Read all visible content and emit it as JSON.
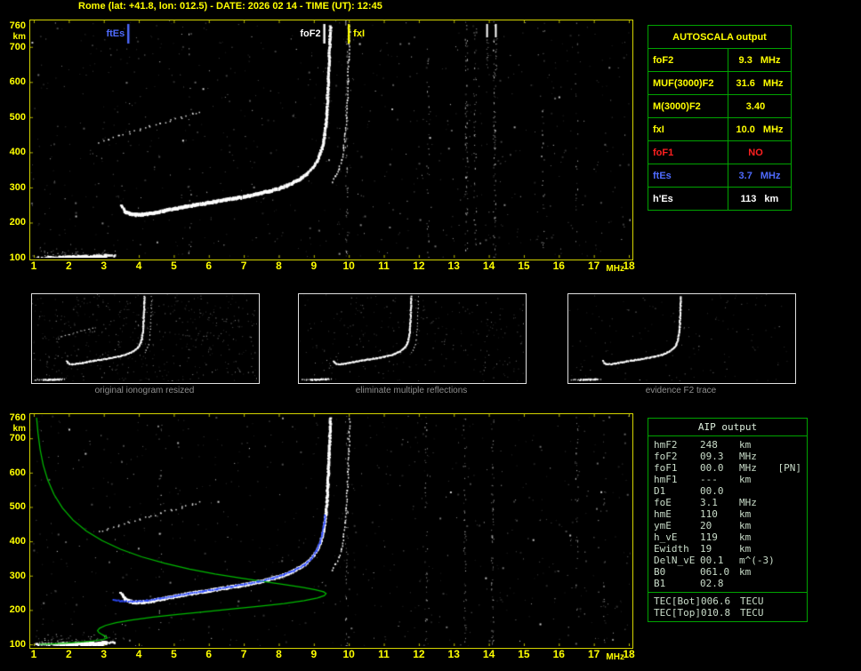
{
  "title": "Rome (lat: +41.8, lon: 012.5) - DATE: 2026 02 14 - TIME (UT): 12:45",
  "axes": {
    "x_unit": "MHz",
    "y_unit": "km",
    "x_ticks": [
      "1",
      "2",
      "3",
      "4",
      "5",
      "6",
      "7",
      "8",
      "9",
      "10",
      "11",
      "12",
      "13",
      "14",
      "15",
      "16",
      "17",
      "18"
    ],
    "y_ticks": [
      "760",
      "700",
      "600",
      "500",
      "400",
      "300",
      "200",
      "100"
    ]
  },
  "main_plot": {
    "markers": [
      {
        "id": "ftEs",
        "label": "ftEs",
        "freq": 3.7,
        "color": "#4f6bff",
        "side": "left"
      },
      {
        "id": "foF2",
        "label": "foF2",
        "freq": 9.3,
        "color": "#ffffff",
        "side": "left"
      },
      {
        "id": "fxI",
        "label": "fxI",
        "freq": 10.0,
        "color": "#ffff00",
        "side": "right"
      }
    ]
  },
  "autoscala_table": {
    "header": "AUTOSCALA output",
    "rows": [
      {
        "label": "foF2",
        "value": "9.3",
        "unit": "MHz",
        "color": "#ffff00"
      },
      {
        "label": "MUF(3000)F2",
        "value": "31.6",
        "unit": "MHz",
        "color": "#ffff00"
      },
      {
        "label": "M(3000)F2",
        "value": "3.40",
        "unit": "",
        "color": "#ffff00"
      },
      {
        "label": "fxI",
        "value": "10.0",
        "unit": "MHz",
        "color": "#ffff00"
      },
      {
        "label": "foF1",
        "value": "NO",
        "unit": "",
        "color": "#ff2020"
      },
      {
        "label": "ftEs",
        "value": "3.7",
        "unit": "MHz",
        "color": "#4f6bff"
      },
      {
        "label": "h'Es",
        "value": "113",
        "unit": "km",
        "color": "#ffffff"
      }
    ]
  },
  "thumbnails": [
    {
      "caption": "original ionogram resized"
    },
    {
      "caption": "eliminate multiple reflections"
    },
    {
      "caption": "evidence F2 trace"
    }
  ],
  "aip_table": {
    "header": "AIP output",
    "rows": [
      {
        "label": "hmF2",
        "value": "248",
        "unit": "km",
        "note": ""
      },
      {
        "label": "foF2",
        "value": "09.3",
        "unit": "MHz",
        "note": ""
      },
      {
        "label": "foF1",
        "value": "00.0",
        "unit": "MHz",
        "note": "[PN]"
      },
      {
        "label": "hmF1",
        "value": "---",
        "unit": "km",
        "note": ""
      },
      {
        "label": "D1",
        "value": "00.0",
        "unit": "",
        "note": ""
      },
      {
        "label": "foE",
        "value": "3.1",
        "unit": "MHz",
        "note": ""
      },
      {
        "label": "hmE",
        "value": "110",
        "unit": "km",
        "note": ""
      },
      {
        "label": "ymE",
        "value": "20",
        "unit": "km",
        "note": ""
      },
      {
        "label": "h_vE",
        "value": "119",
        "unit": "km",
        "note": ""
      },
      {
        "label": "Ewidth",
        "value": "19",
        "unit": "km",
        "note": ""
      },
      {
        "label": "DelN_vE",
        "value": "00.1",
        "unit": "m^(-3)",
        "note": ""
      },
      {
        "label": "B0",
        "value": "061.0",
        "unit": "km",
        "note": ""
      },
      {
        "label": "B1",
        "value": "02.8",
        "unit": "",
        "note": ""
      }
    ],
    "tec_rows": [
      {
        "label": "TEC[Bot]",
        "value": "006.6",
        "unit": "TECU"
      },
      {
        "label": "TEC[Top]",
        "value": "010.8",
        "unit": "TECU"
      }
    ]
  },
  "chart_data": {
    "type": "scatter",
    "xlabel": "MHz",
    "ylabel": "km",
    "xlim": [
      1,
      18
    ],
    "ylim": [
      100,
      760
    ],
    "traces": {
      "f2": [
        [
          3.45,
          252
        ],
        [
          3.55,
          238
        ],
        [
          3.7,
          230
        ],
        [
          3.9,
          227
        ],
        [
          4.1,
          228
        ],
        [
          4.4,
          232
        ],
        [
          4.7,
          238
        ],
        [
          5.0,
          244
        ],
        [
          5.3,
          250
        ],
        [
          5.6,
          255
        ],
        [
          5.9,
          260
        ],
        [
          6.2,
          265
        ],
        [
          6.5,
          270
        ],
        [
          6.8,
          275
        ],
        [
          7.1,
          280
        ],
        [
          7.4,
          287
        ],
        [
          7.7,
          294
        ],
        [
          8.0,
          302
        ],
        [
          8.2,
          310
        ],
        [
          8.4,
          319
        ],
        [
          8.6,
          330
        ],
        [
          8.8,
          344
        ],
        [
          8.95,
          360
        ],
        [
          9.07,
          378
        ],
        [
          9.15,
          398
        ],
        [
          9.22,
          422
        ],
        [
          9.27,
          450
        ],
        [
          9.31,
          482
        ],
        [
          9.34,
          520
        ],
        [
          9.36,
          560
        ],
        [
          9.38,
          605
        ],
        [
          9.4,
          655
        ],
        [
          9.42,
          710
        ],
        [
          9.44,
          760
        ]
      ],
      "f2_x_mode": [
        [
          9.5,
          318
        ],
        [
          9.6,
          335
        ],
        [
          9.7,
          355
        ],
        [
          9.78,
          380
        ],
        [
          9.84,
          415
        ],
        [
          9.88,
          455
        ],
        [
          9.91,
          500
        ],
        [
          9.94,
          550
        ],
        [
          9.96,
          605
        ],
        [
          9.98,
          665
        ],
        [
          10.0,
          720
        ],
        [
          10.01,
          760
        ]
      ],
      "second_hop": [
        [
          2.85,
          428
        ],
        [
          3.1,
          438
        ],
        [
          3.4,
          448
        ],
        [
          3.7,
          457
        ],
        [
          4.0,
          466
        ],
        [
          4.3,
          475
        ],
        [
          4.6,
          484
        ],
        [
          4.9,
          492
        ],
        [
          5.2,
          501
        ],
        [
          5.5,
          510
        ],
        [
          5.7,
          516
        ]
      ],
      "es": [
        [
          1.05,
          103
        ],
        [
          1.4,
          103
        ],
        [
          1.8,
          104
        ],
        [
          2.2,
          105
        ],
        [
          2.6,
          106
        ],
        [
          3.0,
          107
        ],
        [
          3.3,
          109
        ]
      ],
      "es_blob": [
        [
          1.7,
          104
        ],
        [
          2.1,
          105
        ],
        [
          2.5,
          106
        ],
        [
          2.9,
          107
        ],
        [
          3.05,
          108
        ]
      ],
      "profile": [
        [
          1.08,
          760
        ],
        [
          1.12,
          715
        ],
        [
          1.18,
          668
        ],
        [
          1.27,
          622
        ],
        [
          1.4,
          578
        ],
        [
          1.58,
          536
        ],
        [
          1.82,
          497
        ],
        [
          2.12,
          462
        ],
        [
          2.5,
          430
        ],
        [
          2.95,
          402
        ],
        [
          3.48,
          377
        ],
        [
          4.08,
          355
        ],
        [
          4.75,
          336
        ],
        [
          5.45,
          319
        ],
        [
          6.18,
          305
        ],
        [
          6.9,
          293
        ],
        [
          7.58,
          283
        ],
        [
          8.18,
          274
        ],
        [
          8.68,
          266
        ],
        [
          9.05,
          259
        ],
        [
          9.28,
          253
        ],
        [
          9.35,
          248
        ],
        [
          9.3,
          242
        ],
        [
          9.1,
          235
        ],
        [
          8.72,
          227
        ],
        [
          8.15,
          219
        ],
        [
          7.45,
          211
        ],
        [
          6.68,
          203
        ],
        [
          5.88,
          195
        ],
        [
          5.1,
          187
        ],
        [
          4.4,
          179
        ],
        [
          3.8,
          171
        ],
        [
          3.35,
          163
        ],
        [
          3.05,
          155
        ],
        [
          2.88,
          147
        ],
        [
          2.82,
          140
        ],
        [
          2.86,
          134
        ],
        [
          2.96,
          128
        ],
        [
          3.06,
          123
        ],
        [
          3.1,
          119
        ],
        [
          2.98,
          114
        ],
        [
          2.7,
          110
        ],
        [
          2.3,
          106
        ],
        [
          1.85,
          103
        ],
        [
          1.45,
          101
        ],
        [
          1.15,
          100
        ]
      ],
      "fit": [
        [
          3.25,
          232
        ],
        [
          3.5,
          228
        ],
        [
          3.8,
          227
        ],
        [
          4.2,
          230
        ],
        [
          4.6,
          236
        ],
        [
          5.0,
          243
        ],
        [
          5.4,
          250
        ],
        [
          5.8,
          257
        ],
        [
          6.2,
          263
        ],
        [
          6.6,
          270
        ],
        [
          7.0,
          277
        ],
        [
          7.4,
          285
        ],
        [
          7.8,
          295
        ],
        [
          8.1,
          305
        ],
        [
          8.4,
          317
        ],
        [
          8.7,
          333
        ],
        [
          8.9,
          352
        ],
        [
          9.05,
          374
        ],
        [
          9.15,
          398
        ],
        [
          9.22,
          424
        ],
        [
          9.27,
          452
        ],
        [
          9.3,
          478
        ]
      ]
    },
    "noise": {
      "rfi_main": [
        {
          "x": 5.45,
          "d": 0.1
        },
        {
          "x": 9.93,
          "d": 0.35
        },
        {
          "x": 12.25,
          "d": 0.15
        },
        {
          "x": 13.35,
          "d": 0.35
        },
        {
          "x": 13.6,
          "d": 0.2
        },
        {
          "x": 14.15,
          "d": 0.4
        },
        {
          "x": 15.55,
          "d": 0.12
        },
        {
          "x": 16.5,
          "d": 0.1
        }
      ],
      "rfi_bottom": [
        {
          "x": 4.6,
          "d": 0.1
        },
        {
          "x": 9.93,
          "d": 0.25
        },
        {
          "x": 12.2,
          "d": 0.2
        },
        {
          "x": 13.3,
          "d": 0.25
        },
        {
          "x": 14.1,
          "d": 0.3
        },
        {
          "x": 16.5,
          "d": 0.15
        },
        {
          "x": 17.3,
          "d": 0.1
        }
      ],
      "top_bars_main": [
        13.95,
        14.2
      ],
      "top_bars_bottom": []
    }
  }
}
